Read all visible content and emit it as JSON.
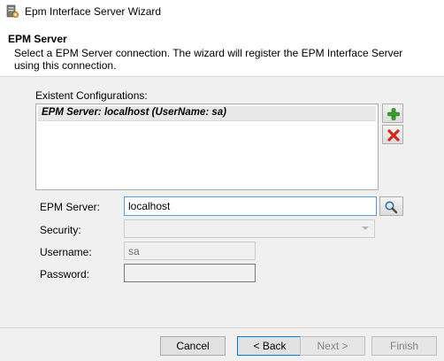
{
  "window": {
    "title": "Epm Interface Server Wizard",
    "icon": "server-gear-icon"
  },
  "header": {
    "title": "EPM Server",
    "description": "Select a EPM Server connection. The wizard will register the EPM Interface Server using this connection."
  },
  "configurations": {
    "label": "Existent Configurations:",
    "items": [
      "EPM Server: localhost (UserName: sa)"
    ],
    "add_icon": "green-plus-icon",
    "remove_icon": "red-x-icon"
  },
  "form": {
    "epm_server": {
      "label": "EPM Server:",
      "value": "localhost",
      "search_icon": "magnifier-icon"
    },
    "security": {
      "label": "Security:",
      "value": ""
    },
    "username": {
      "label": "Username:",
      "value": "sa"
    },
    "password": {
      "label": "Password:",
      "value": ""
    }
  },
  "buttons": {
    "cancel": "Cancel",
    "back": "< Back",
    "next": "Next >",
    "finish": "Finish"
  },
  "colors": {
    "accent_border": "#569de5",
    "plus": "#3aa12c",
    "remove": "#d9261c"
  }
}
